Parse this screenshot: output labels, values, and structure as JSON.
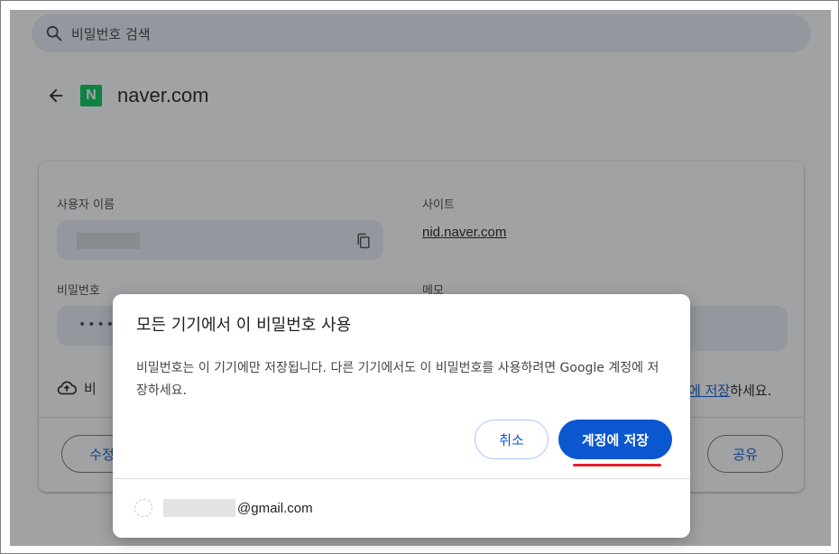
{
  "search": {
    "placeholder": "비밀번호 검색"
  },
  "site": {
    "logo_letter": "N",
    "title": "naver.com"
  },
  "details": {
    "username_label": "사용자 이름",
    "site_label": "사이트",
    "site_link": "nid.naver.com",
    "password_label": "비밀번호",
    "password_mask": "•••••",
    "memo_label": "메모",
    "save_row_prefix": "비",
    "save_row_link": "에 저장",
    "save_row_suffix": "하세요.",
    "edit_button_partial": "수정",
    "share_button": "공유"
  },
  "dialog": {
    "title": "모든 기기에서 이 비밀번호 사용",
    "body": "비밀번호는 이 기기에만 저장됩니다. 다른 기기에서도 이 비밀번호를 사용하려면 Google 계정에 저장하세요.",
    "cancel_label": "취소",
    "save_label": "계정에 저장",
    "account_email_suffix": "@gmail.com"
  },
  "colors": {
    "accent": "#0b57d0",
    "highlight_underline": "#e0202a",
    "naver_green": "#03c75a"
  },
  "icons": {
    "search": "search-icon",
    "back": "back-arrow-icon",
    "copy": "copy-icon",
    "cloud_upload": "cloud-upload-icon"
  }
}
